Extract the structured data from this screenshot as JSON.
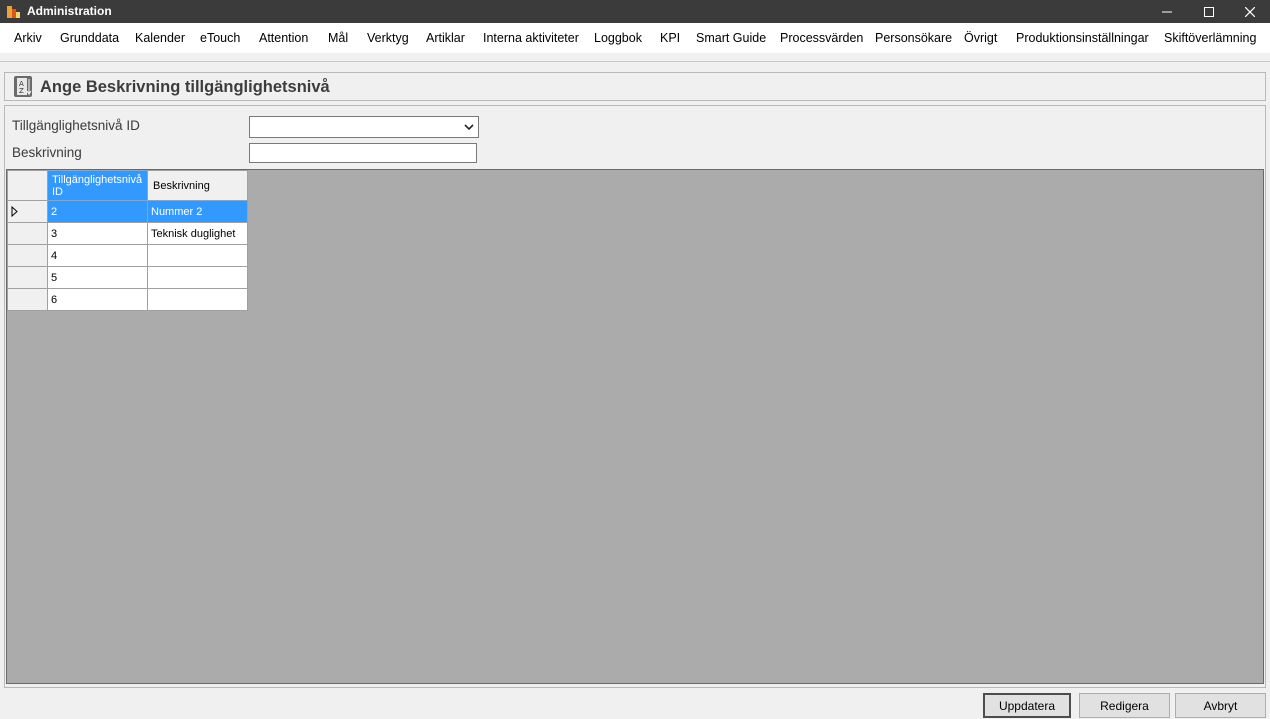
{
  "window": {
    "title": "Administration"
  },
  "menu": [
    "Arkiv",
    "Grunddata",
    "Kalender",
    "eTouch",
    "Attention",
    "Mål",
    "Verktyg",
    "Artiklar",
    "Interna aktiviteter",
    "Loggbok",
    "KPI",
    "Smart Guide",
    "Processvärden",
    "Personsökare",
    "Övrigt",
    "Produktionsinställningar",
    "Skiftöverlämning"
  ],
  "page": {
    "title": "Ange Beskrivning tillgänglighetsnivå",
    "icon": "az-sort-icon"
  },
  "form": {
    "id_label": "Tillgänglighetsnivå ID",
    "id_value": "",
    "desc_label": "Beskrivning",
    "desc_value": ""
  },
  "grid": {
    "columns": [
      "Tillgänglighetsnivå ID",
      "Beskrivning"
    ],
    "rows": [
      {
        "id": "2",
        "desc": "Nummer 2",
        "selected": true
      },
      {
        "id": "3",
        "desc": "Teknisk duglighet",
        "selected": false
      },
      {
        "id": "4",
        "desc": "",
        "selected": false
      },
      {
        "id": "5",
        "desc": "",
        "selected": false
      },
      {
        "id": "6",
        "desc": "",
        "selected": false
      }
    ],
    "selection_color": "#3399ff",
    "background_color": "#ababab"
  },
  "buttons": {
    "update": "Uppdatera",
    "edit": "Redigera",
    "cancel": "Avbryt"
  }
}
